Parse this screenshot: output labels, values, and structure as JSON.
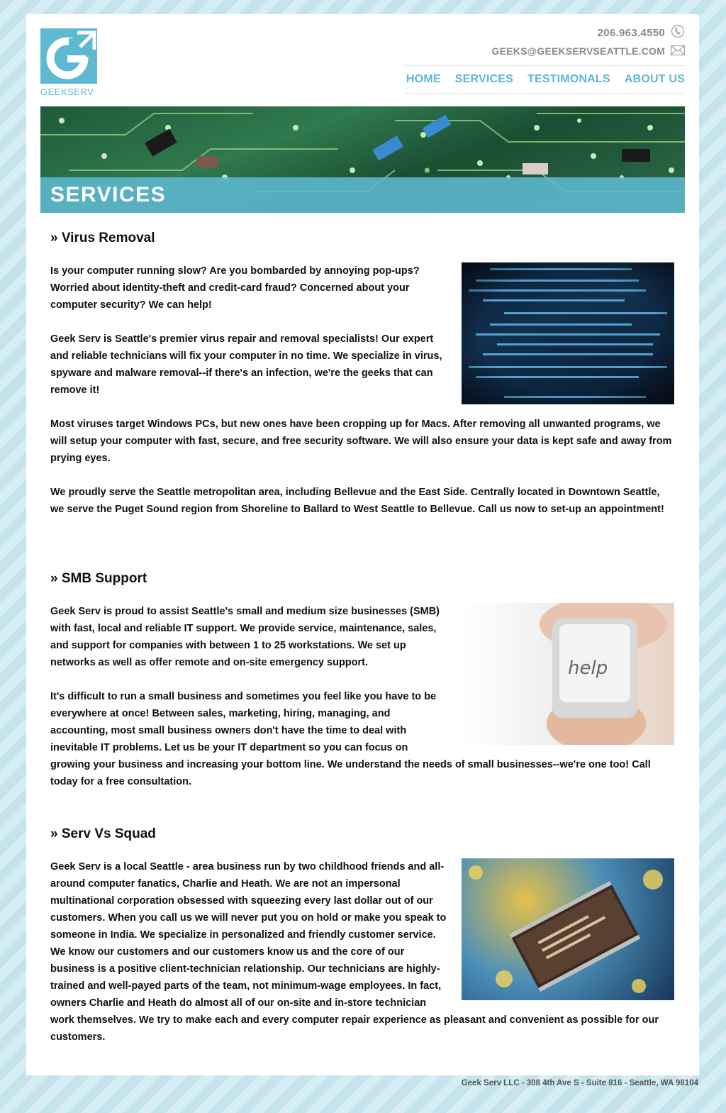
{
  "brand": {
    "logo_letter": "G",
    "name": "GEEKSERV",
    "accent": "#5db8d0"
  },
  "contact": {
    "phone": "206.963.4550",
    "phone_icon": "phone-icon",
    "email": "GEEKS@GEEKSERVSEATTLE.COM",
    "email_icon": "envelope-icon"
  },
  "nav": {
    "home": "HOME",
    "services": "SERVICES",
    "testimonials": "TESTIMONALS",
    "about": "ABOUT US"
  },
  "banner": {
    "title": "SERVICES"
  },
  "sections": [
    {
      "heading": "» Virus Removal",
      "image": "code-screen-image",
      "paragraphs": [
        "Is your computer running slow? Are you bombarded by annoying pop-ups? Worried about identity-theft and credit-card fraud? Concerned about your computer security? We can help!",
        "Geek Serv is Seattle's premier virus repair and removal specialists! Our expert and reliable technicians will fix your computer in no time. We specialize in virus, spyware and malware removal--if there's an infection, we're the geeks that can remove it!",
        "Most viruses target Windows PCs, but new ones have been cropping up for Macs. After removing all unwanted programs, we will setup your computer with fast, secure, and free security software. We will also ensure your data is kept safe and away from prying eyes.",
        "We proudly serve the Seattle metropolitan area, including Bellevue and the East Side. Centrally located in Downtown Seattle, we serve the Puget Sound region from Shoreline to Ballard to West Seattle to Bellevue. Call us now to set-up an appointment!"
      ]
    },
    {
      "heading": "» SMB Support",
      "image": "help-key-image",
      "image_text": "help",
      "paragraphs": [
        "Geek Serv is proud to assist Seattle's small and medium size businesses (SMB) with fast, local and reliable IT support. We provide service, maintenance, sales, and support for companies with between 1 to 25 workstations. We set up networks as well as offer remote and on-site emergency support.",
        "It's difficult to run a small business and sometimes you feel like you have to be everywhere at once! Between sales, marketing, hiring, managing, and accounting, most small business owners don't have the time to deal with inevitable IT problems. Let us be your IT department so you can focus on growing your business and increasing your bottom line. We understand the needs of small businesses--we're one too! Call today for a free consultation."
      ]
    },
    {
      "heading": "» Serv Vs Squad",
      "image": "circuit-chip-image",
      "paragraphs": [
        "Geek Serv is a local Seattle - area business run by two childhood friends and all-around computer fanatics, Charlie and Heath. We are not an impersonal multinational corporation obsessed with squeezing every last dollar out of our customers. When you call us we will never put you on hold or make you speak to someone in India. We specialize in personalized and friendly customer service. We know our customers and our customers know us and the core of our business is a positive client-technician relationship. Our technicians are highly-trained and well-payed parts of the team, not minimum-wage employees. In fact, owners Charlie and Heath do almost all of our on-site and in-store technician work themselves. We try to make each and every computer repair experience as pleasant and convenient as possible for our customers."
      ]
    }
  ],
  "footer": {
    "address": "Geek Serv LLC - 308 4th Ave S - Suite 816 - Seattle, WA 98104"
  }
}
